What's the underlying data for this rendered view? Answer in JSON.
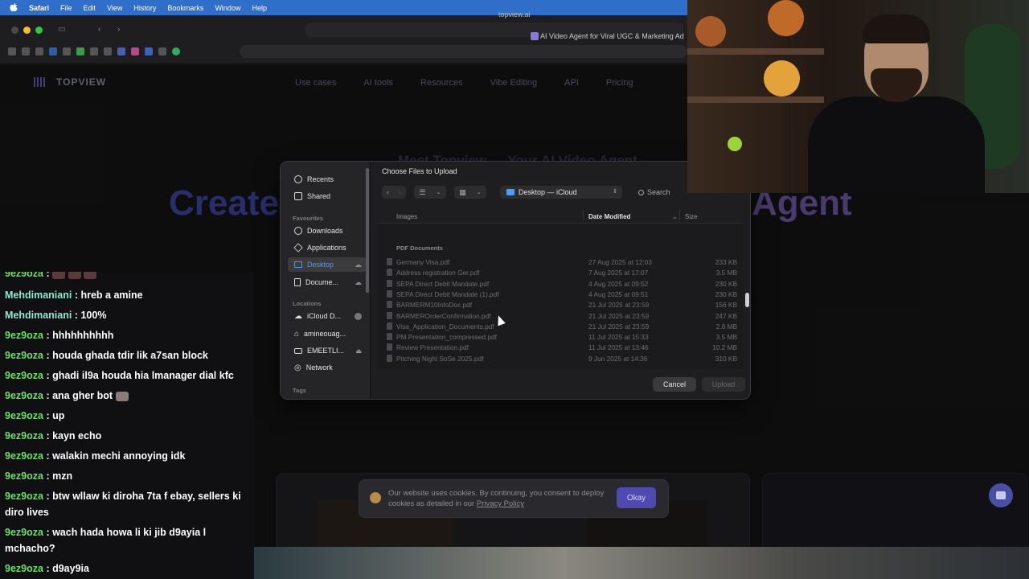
{
  "menubar": {
    "app": "Safari",
    "items": [
      "File",
      "Edit",
      "View",
      "History",
      "Bookmarks",
      "Window",
      "Help"
    ]
  },
  "browser": {
    "url": "topview.ai",
    "tab_title": "AI Video Agent for Viral UGC & Marketing Ad"
  },
  "site": {
    "logo": "TOPVIEW",
    "nav": [
      "Use cases",
      "AI tools",
      "Resources",
      "Vibe Editing",
      "API",
      "Pricing"
    ],
    "hero_sub": "Meet Topview — Your AI Video Agent",
    "hero_left": "Create",
    "hero_right": "Agent",
    "cookie_text": "Our website uses cookies. By continuing, you consent to deploy cookies as detailed in our",
    "cookie_link": "Privacy Policy",
    "cookie_button": "Okay"
  },
  "dialog": {
    "title": "Choose Files to Upload",
    "location": "Desktop — iCloud",
    "search_placeholder": "Search",
    "sidebar": {
      "items_top": [
        "Recents",
        "Shared"
      ],
      "favourites_head": "Favourites",
      "favourites": [
        "Downloads",
        "Applications",
        "Desktop",
        "Docume..."
      ],
      "locations_head": "Locations",
      "locations": [
        "iCloud D...",
        "amineouag...",
        "EMEETLI...",
        "Network"
      ],
      "tags_head": "Tags"
    },
    "columns": {
      "name": "Images",
      "date": "Date Modified",
      "size": "Size"
    },
    "group": "PDF Documents",
    "files": [
      {
        "name": "Germany Visa.pdf",
        "date": "27 Aug 2025 at 12:03",
        "size": "233 KB"
      },
      {
        "name": "Address registration Ger.pdf",
        "date": "7 Aug 2025 at 17:07",
        "size": "3.5 MB"
      },
      {
        "name": "SEPA Direct Debit Mandate.pdf",
        "date": "4 Aug 2025 at 09:52",
        "size": "230 KB"
      },
      {
        "name": "SEPA Direct Debit Mandate (1).pdf",
        "date": "4 Aug 2025 at 09:51",
        "size": "230 KB"
      },
      {
        "name": "BARMERM10InfoDoc.pdf",
        "date": "21 Jul 2025 at 23:59",
        "size": "156 KB"
      },
      {
        "name": "BARMEROrderConfirmation.pdf",
        "date": "21 Jul 2025 at 23:59",
        "size": "247 KB"
      },
      {
        "name": "Visa_Application_Documents.pdf",
        "date": "21 Jul 2025 at 23:59",
        "size": "2.8 MB"
      },
      {
        "name": "PM Presentation_compressed.pdf",
        "date": "11 Jul 2025 at 15:33",
        "size": "3.5 MB"
      },
      {
        "name": "Review Presentation.pdf",
        "date": "11 Jul 2025 at 13:46",
        "size": "10.2 MB"
      },
      {
        "name": "Pitching Night SoSe 2025.pdf",
        "date": "9 Jun 2025 at 14:36",
        "size": "310 KB"
      }
    ],
    "cancel": "Cancel",
    "upload": "Upload"
  },
  "chat": [
    {
      "nick": "9ez9oza",
      "text": ":",
      "type": "g"
    },
    {
      "nick": "Mehdimaniani",
      "text": ": hreb a amine",
      "type": "m"
    },
    {
      "nick": "Mehdimaniani",
      "text": ": 100%",
      "type": "m"
    },
    {
      "nick": "9ez9oza",
      "text": ": hhhhhhhhhh",
      "type": "g"
    },
    {
      "nick": "9ez9oza",
      "text": ": houda ghada tdir lik a7san block",
      "type": "g"
    },
    {
      "nick": "9ez9oza",
      "text": ": ghadi il9a houda hia lmanager dial kfc",
      "type": "g"
    },
    {
      "nick": "9ez9oza",
      "text": ": ana gher bot",
      "type": "g"
    },
    {
      "nick": "9ez9oza",
      "text": ": up",
      "type": "g"
    },
    {
      "nick": "9ez9oza",
      "text": ": kayn echo",
      "type": "g"
    },
    {
      "nick": "9ez9oza",
      "text": ": walakin mechi annoying idk",
      "type": "g"
    },
    {
      "nick": "9ez9oza",
      "text": ": mzn",
      "type": "g"
    },
    {
      "nick": "9ez9oza",
      "text": ": btw wllaw ki diroha 7ta f ebay, sellers ki diro lives",
      "type": "g"
    },
    {
      "nick": "9ez9oza",
      "text": ": wach hada howa li ki jib d9ayia l mchacho?",
      "type": "g"
    },
    {
      "nick": "9ez9oza",
      "text": ": d9ay9ia",
      "type": "g"
    }
  ]
}
